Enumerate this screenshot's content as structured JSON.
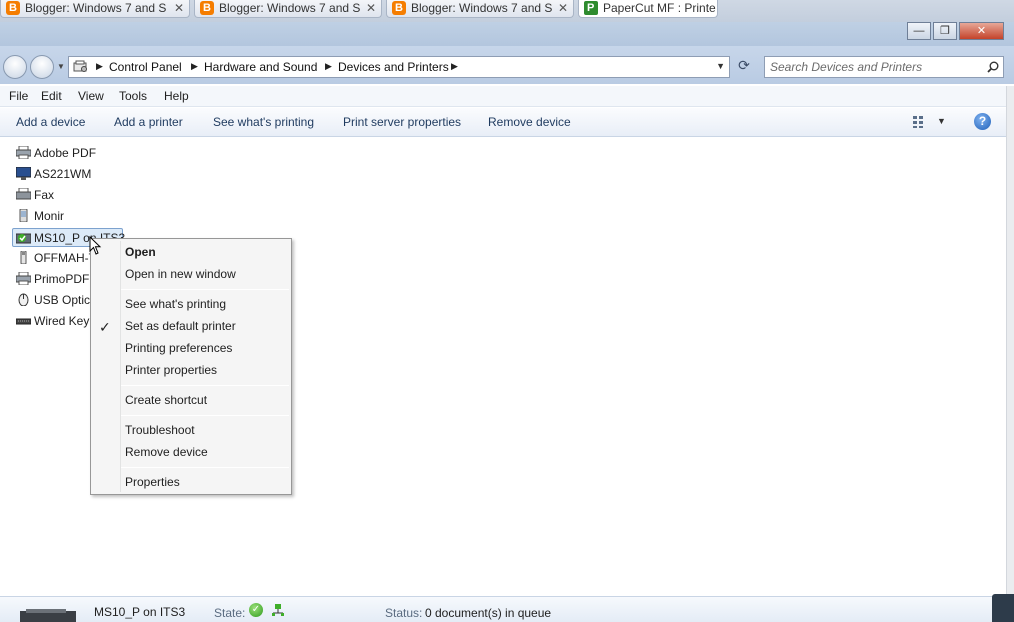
{
  "browser_tabs": [
    {
      "label": "Blogger: Windows 7 and S",
      "icon": "blogger-icon"
    },
    {
      "label": "Blogger: Windows 7 and S",
      "icon": "blogger-icon"
    },
    {
      "label": "Blogger: Windows 7 and S",
      "icon": "blogger-icon"
    },
    {
      "label": "PaperCut MF : Printe",
      "icon": "papercut-icon"
    }
  ],
  "window_buttons": {
    "minimize": "—",
    "maximize": "❐",
    "close": "✕"
  },
  "breadcrumb": [
    "Control Panel",
    "Hardware and Sound",
    "Devices and Printers"
  ],
  "search": {
    "placeholder": "Search Devices and Printers"
  },
  "menu": [
    "File",
    "Edit",
    "View",
    "Tools",
    "Help"
  ],
  "commands": [
    "Add a device",
    "Add a printer",
    "See what's printing",
    "Print server properties",
    "Remove device"
  ],
  "devices": [
    {
      "label": "Adobe PDF",
      "icon": "printer-icon"
    },
    {
      "label": "AS221WM",
      "icon": "monitor-icon"
    },
    {
      "label": "Fax",
      "icon": "fax-icon"
    },
    {
      "label": "Monir",
      "icon": "phone-icon"
    },
    {
      "label": "MS10_P on ITS3",
      "icon": "network-printer-icon",
      "selected": true
    },
    {
      "label": "OFFMAH-T",
      "icon": "usb-drive-icon"
    },
    {
      "label": "PrimoPDF",
      "icon": "printer-icon"
    },
    {
      "label": "USB Optica",
      "icon": "mouse-icon"
    },
    {
      "label": "Wired Keyb",
      "icon": "keyboard-icon"
    }
  ],
  "context_menu": {
    "items": [
      {
        "label": "Open",
        "bold": true
      },
      {
        "label": "Open in new window"
      },
      {
        "label": "See what's printing"
      },
      {
        "label": "Set as default printer",
        "checked": true
      },
      {
        "label": "Printing preferences"
      },
      {
        "label": "Printer properties"
      },
      {
        "label": "Create shortcut"
      },
      {
        "label": "Troubleshoot"
      },
      {
        "label": "Remove device"
      },
      {
        "label": "Properties"
      }
    ],
    "check_mark": "✓"
  },
  "details": {
    "name": "MS10_P on ITS3",
    "state_label": "State:",
    "status_label": "Status:",
    "status_value": "0 document(s) in queue"
  },
  "colors": {
    "accent": "#1f5fb8",
    "selection": "#dceaf8",
    "chrome": "#b9cbe3"
  }
}
